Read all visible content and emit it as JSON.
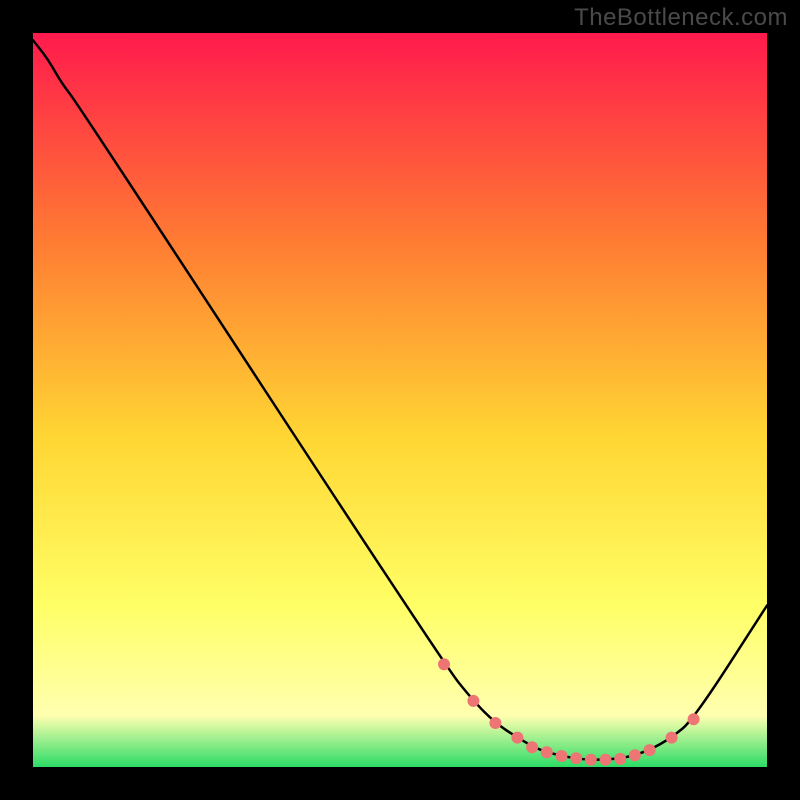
{
  "watermark": "TheBottleneck.com",
  "colors": {
    "background_black": "#000000",
    "gradient_top": "#ff1a4d",
    "gradient_mid1": "#ff7a33",
    "gradient_mid2": "#ffd633",
    "gradient_mid3": "#ffff66",
    "gradient_mid4": "#ffffb0",
    "gradient_bottom": "#2bdc66",
    "curve_stroke": "#000000",
    "dot_fill": "#ed7573"
  },
  "chart_data": {
    "type": "line",
    "title": "",
    "xlabel": "",
    "ylabel": "",
    "xlim": [
      0,
      100
    ],
    "ylim": [
      0,
      100
    ],
    "x": [
      0,
      2,
      4,
      6,
      56,
      60,
      63,
      66,
      69,
      72,
      75,
      78,
      81,
      84,
      87,
      90,
      100
    ],
    "values": [
      99,
      96.5,
      93,
      90.5,
      14,
      9,
      6,
      4,
      2.3,
      1.5,
      1,
      1,
      1.3,
      2.3,
      4,
      6.5,
      22
    ],
    "dots_x": [
      56,
      60,
      63,
      66,
      68,
      70,
      72,
      74,
      76,
      78,
      80,
      82,
      84,
      87,
      90
    ],
    "dots_y": [
      14,
      9,
      6,
      4,
      2.7,
      2,
      1.5,
      1.2,
      1,
      1,
      1.1,
      1.6,
      2.3,
      4,
      6.5
    ]
  }
}
